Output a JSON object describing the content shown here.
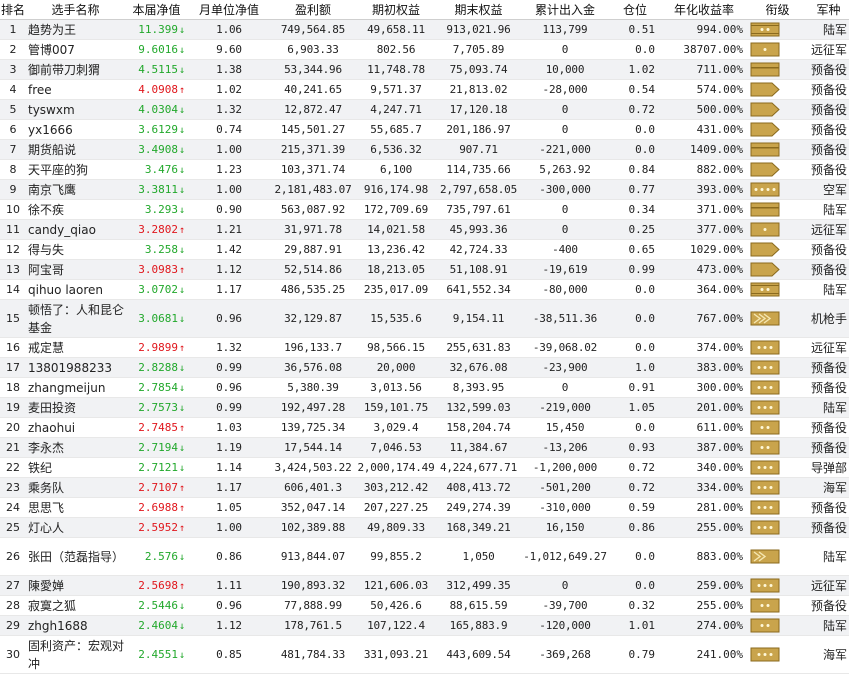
{
  "headers": [
    "排名",
    "选手名称",
    "本届净值",
    "月单位净值",
    "盈利额",
    "期初权益",
    "期末权益",
    "累计出入金",
    "仓位",
    "年化收益率",
    "衔级",
    "军种"
  ],
  "rows": [
    {
      "rank": "1",
      "name": "趋势为王",
      "nav": "11.399",
      "dir": "down",
      "unit": "1.06",
      "profit": "749,564.85",
      "initial": "49,658.11",
      "final": "913,021.96",
      "flow": "113,799",
      "position": "0.51",
      "annual": "994.00%",
      "badge": "colonel",
      "arm": "陆军"
    },
    {
      "rank": "2",
      "name": "管博007",
      "nav": "9.6016",
      "dir": "down",
      "unit": "9.60",
      "profit": "6,903.33",
      "initial": "802.56",
      "final": "7,705.89",
      "flow": "0",
      "position": "0.0",
      "annual": "38707.00%",
      "badge": "major",
      "arm": "远征军"
    },
    {
      "rank": "3",
      "name": "御前带刀刺猬",
      "nav": "4.5115",
      "dir": "down",
      "unit": "1.38",
      "profit": "53,344.96",
      "initial": "11,748.78",
      "final": "75,093.74",
      "flow": "10,000",
      "position": "1.02",
      "annual": "711.00%",
      "badge": "sergeant",
      "arm": "预备役"
    },
    {
      "rank": "4",
      "name": "free",
      "nav": "4.0908",
      "dir": "up",
      "unit": "1.02",
      "profit": "40,241.65",
      "initial": "9,571.37",
      "final": "21,813.02",
      "flow": "-28,000",
      "position": "0.54",
      "annual": "574.00%",
      "badge": "corporal",
      "arm": "预备役"
    },
    {
      "rank": "5",
      "name": "tyswxm",
      "nav": "4.0304",
      "dir": "down",
      "unit": "1.32",
      "profit": "12,872.47",
      "initial": "4,247.71",
      "final": "17,120.18",
      "flow": "0",
      "position": "0.72",
      "annual": "500.00%",
      "badge": "corporal",
      "arm": "预备役"
    },
    {
      "rank": "6",
      "name": "yx1666",
      "nav": "3.6129",
      "dir": "down",
      "unit": "0.74",
      "profit": "145,501.27",
      "initial": "55,685.7",
      "final": "201,186.97",
      "flow": "0",
      "position": "0.0",
      "annual": "431.00%",
      "badge": "corporal",
      "arm": "预备役"
    },
    {
      "rank": "7",
      "name": "期货船说",
      "nav": "3.4908",
      "dir": "down",
      "unit": "1.00",
      "profit": "215,371.39",
      "initial": "6,536.32",
      "final": "907.71",
      "flow": "-221,000",
      "position": "0.0",
      "annual": "1409.00%",
      "badge": "sergeant",
      "arm": "预备役"
    },
    {
      "rank": "8",
      "name": "天平座的狗",
      "nav": "3.476",
      "dir": "down",
      "unit": "1.23",
      "profit": "103,371.74",
      "initial": "6,100",
      "final": "114,735.66",
      "flow": "5,263.92",
      "position": "0.84",
      "annual": "882.00%",
      "badge": "corporal",
      "arm": "预备役"
    },
    {
      "rank": "9",
      "name": "南京飞鹰",
      "nav": "3.3811",
      "dir": "down",
      "unit": "1.00",
      "profit": "2,181,483.07",
      "initial": "916,174.98",
      "final": "2,797,658.05",
      "flow": "-300,000",
      "position": "0.77",
      "annual": "393.00%",
      "badge": "general",
      "arm": "空军"
    },
    {
      "rank": "10",
      "name": "徐不疾",
      "nav": "3.293",
      "dir": "down",
      "unit": "0.90",
      "profit": "563,087.92",
      "initial": "172,709.69",
      "final": "735,797.61",
      "flow": "0",
      "position": "0.34",
      "annual": "371.00%",
      "badge": "sergeant",
      "arm": "陆军"
    },
    {
      "rank": "11",
      "name": "candy_qiao",
      "nav": "3.2802",
      "dir": "up",
      "unit": "1.21",
      "profit": "31,971.78",
      "initial": "14,021.58",
      "final": "45,993.36",
      "flow": "0",
      "position": "0.25",
      "annual": "377.00%",
      "badge": "major",
      "arm": "远征军"
    },
    {
      "rank": "12",
      "name": "得与失",
      "nav": "3.258",
      "dir": "down",
      "unit": "1.42",
      "profit": "29,887.91",
      "initial": "13,236.42",
      "final": "42,724.33",
      "flow": "-400",
      "position": "0.65",
      "annual": "1029.00%",
      "badge": "corporal",
      "arm": "预备役"
    },
    {
      "rank": "13",
      "name": "阿宝哥",
      "nav": "3.0983",
      "dir": "up",
      "unit": "1.12",
      "profit": "52,514.86",
      "initial": "18,213.05",
      "final": "51,108.91",
      "flow": "-19,619",
      "position": "0.99",
      "annual": "473.00%",
      "badge": "corporal",
      "arm": "预备役"
    },
    {
      "rank": "14",
      "name": "qihuo laoren",
      "nav": "3.0702",
      "dir": "down",
      "unit": "1.17",
      "profit": "486,535.25",
      "initial": "235,017.09",
      "final": "641,552.34",
      "flow": "-80,000",
      "position": "0.0",
      "annual": "364.00%",
      "badge": "colonel",
      "arm": "陆军"
    },
    {
      "rank": "15",
      "name": "顿悟了：人和昆仑基金",
      "nav": "3.0681",
      "dir": "down",
      "unit": "0.96",
      "profit": "32,129.87",
      "initial": "15,535.6",
      "final": "9,154.11",
      "flow": "-38,511.36",
      "position": "0.0",
      "annual": "767.00%",
      "badge": "chevron",
      "arm": "机枪手"
    },
    {
      "rank": "16",
      "name": "戒定慧",
      "nav": "2.9899",
      "dir": "up",
      "unit": "1.32",
      "profit": "196,133.7",
      "initial": "98,566.15",
      "final": "255,631.83",
      "flow": "-39,068.02",
      "position": "0.0",
      "annual": "374.00%",
      "badge": "major3",
      "arm": "远征军"
    },
    {
      "rank": "17",
      "name": "13801988233",
      "nav": "2.8288",
      "dir": "down",
      "unit": "0.99",
      "profit": "36,576.08",
      "initial": "20,000",
      "final": "32,676.08",
      "flow": "-23,900",
      "position": "1.0",
      "annual": "383.00%",
      "badge": "major3",
      "arm": "预备役"
    },
    {
      "rank": "18",
      "name": "zhangmeijun",
      "nav": "2.7854",
      "dir": "down",
      "unit": "0.96",
      "profit": "5,380.39",
      "initial": "3,013.56",
      "final": "8,393.95",
      "flow": "0",
      "position": "0.91",
      "annual": "300.00%",
      "badge": "major3",
      "arm": "预备役"
    },
    {
      "rank": "19",
      "name": "麦田投资",
      "nav": "2.7573",
      "dir": "down",
      "unit": "0.99",
      "profit": "192,497.28",
      "initial": "159,101.75",
      "final": "132,599.03",
      "flow": "-219,000",
      "position": "1.05",
      "annual": "201.00%",
      "badge": "major3",
      "arm": "陆军"
    },
    {
      "rank": "20",
      "name": "zhaohui",
      "nav": "2.7485",
      "dir": "up",
      "unit": "1.03",
      "profit": "139,725.34",
      "initial": "3,029.4",
      "final": "158,204.74",
      "flow": "15,450",
      "position": "0.0",
      "annual": "611.00%",
      "badge": "major2",
      "arm": "预备役"
    },
    {
      "rank": "21",
      "name": "李永杰",
      "nav": "2.7194",
      "dir": "down",
      "unit": "1.19",
      "profit": "17,544.14",
      "initial": "7,046.53",
      "final": "11,384.67",
      "flow": "-13,206",
      "position": "0.93",
      "annual": "387.00%",
      "badge": "major2",
      "arm": "预备役"
    },
    {
      "rank": "22",
      "name": "铁纪",
      "nav": "2.7121",
      "dir": "down",
      "unit": "1.14",
      "profit": "3,424,503.22",
      "initial": "2,000,174.49",
      "final": "4,224,677.71",
      "flow": "-1,200,000",
      "position": "0.72",
      "annual": "340.00%",
      "badge": "major3",
      "arm": "导弹部"
    },
    {
      "rank": "23",
      "name": "乘务队",
      "nav": "2.7107",
      "dir": "up",
      "unit": "1.17",
      "profit": "606,401.3",
      "initial": "303,212.42",
      "final": "408,413.72",
      "flow": "-501,200",
      "position": "0.72",
      "annual": "334.00%",
      "badge": "major3",
      "arm": "海军"
    },
    {
      "rank": "24",
      "name": "思思飞",
      "nav": "2.6988",
      "dir": "up",
      "unit": "1.05",
      "profit": "352,047.14",
      "initial": "207,227.25",
      "final": "249,274.39",
      "flow": "-310,000",
      "position": "0.59",
      "annual": "281.00%",
      "badge": "major3",
      "arm": "预备役"
    },
    {
      "rank": "25",
      "name": "灯心人",
      "nav": "2.5952",
      "dir": "up",
      "unit": "1.00",
      "profit": "102,389.88",
      "initial": "49,809.33",
      "final": "168,349.21",
      "flow": "16,150",
      "position": "0.86",
      "annual": "255.00%",
      "badge": "major3",
      "arm": "预备役"
    },
    {
      "rank": "26",
      "name": "张田（范磊指导）",
      "nav": "2.576",
      "dir": "down",
      "unit": "0.86",
      "profit": "913,844.07",
      "initial": "99,855.2",
      "final": "1,050",
      "flow": "-1,012,649.27",
      "position": "0.0",
      "annual": "883.00%",
      "badge": "chevron2",
      "arm": "陆军"
    },
    {
      "rank": "27",
      "name": "陳愛婵",
      "nav": "2.5698",
      "dir": "up",
      "unit": "1.11",
      "profit": "190,893.32",
      "initial": "121,606.03",
      "final": "312,499.35",
      "flow": "0",
      "position": "0.0",
      "annual": "259.00%",
      "badge": "major3",
      "arm": "远征军"
    },
    {
      "rank": "28",
      "name": "寂寞之狐",
      "nav": "2.5446",
      "dir": "down",
      "unit": "0.96",
      "profit": "77,888.99",
      "initial": "50,426.6",
      "final": "88,615.59",
      "flow": "-39,700",
      "position": "0.32",
      "annual": "255.00%",
      "badge": "major2",
      "arm": "预备役"
    },
    {
      "rank": "29",
      "name": "zhgh1688",
      "nav": "2.4604",
      "dir": "down",
      "unit": "1.12",
      "profit": "178,761.5",
      "initial": "107,122.4",
      "final": "165,883.9",
      "flow": "-120,000",
      "position": "1.01",
      "annual": "274.00%",
      "badge": "major2",
      "arm": "陆军"
    },
    {
      "rank": "30",
      "name": "固利资产：宏观对冲",
      "nav": "2.4551",
      "dir": "down",
      "unit": "0.85",
      "profit": "481,784.33",
      "initial": "331,093.21",
      "final": "443,609.54",
      "flow": "-369,268",
      "position": "0.79",
      "annual": "241.00%",
      "badge": "major3",
      "arm": "海军"
    }
  ],
  "colors": {
    "up": "#e0161c",
    "down": "#21a82b",
    "badge_fill": "#c9a44c",
    "badge_border": "#8a6a1e"
  }
}
